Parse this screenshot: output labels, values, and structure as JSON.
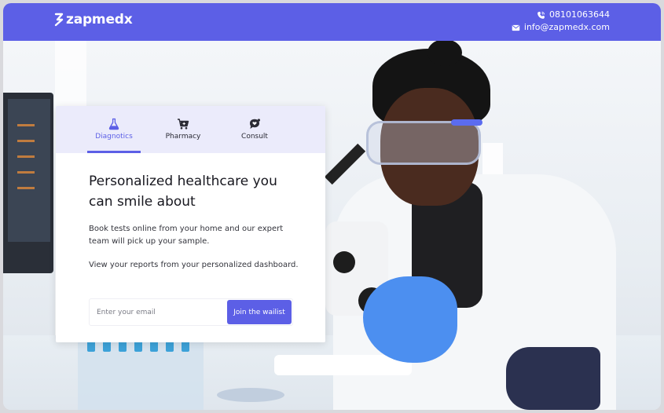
{
  "header": {
    "brand_name": "zapmedx",
    "phone": "08101063644",
    "email": "info@zapmedx.com",
    "phone_icon": "phone-icon",
    "email_icon": "envelope-icon"
  },
  "card": {
    "tabs": [
      {
        "label": "Diagnotics",
        "icon": "flask-icon",
        "active": true
      },
      {
        "label": "Pharmacy",
        "icon": "cart-icon",
        "active": false
      },
      {
        "label": "Consult",
        "icon": "chat-heart-icon",
        "active": false
      }
    ],
    "headline": "Personalized healthcare you can smile about",
    "paragraph_1": "Book tests online from your home and our expert team will pick up your sample.",
    "paragraph_2": "View your reports from your personalized dashboard.",
    "email_placeholder": "Enter your email",
    "cta_label": "Join the wailist"
  },
  "colors": {
    "accent": "#5c5fe6",
    "tab_bg": "#ebebfb"
  }
}
